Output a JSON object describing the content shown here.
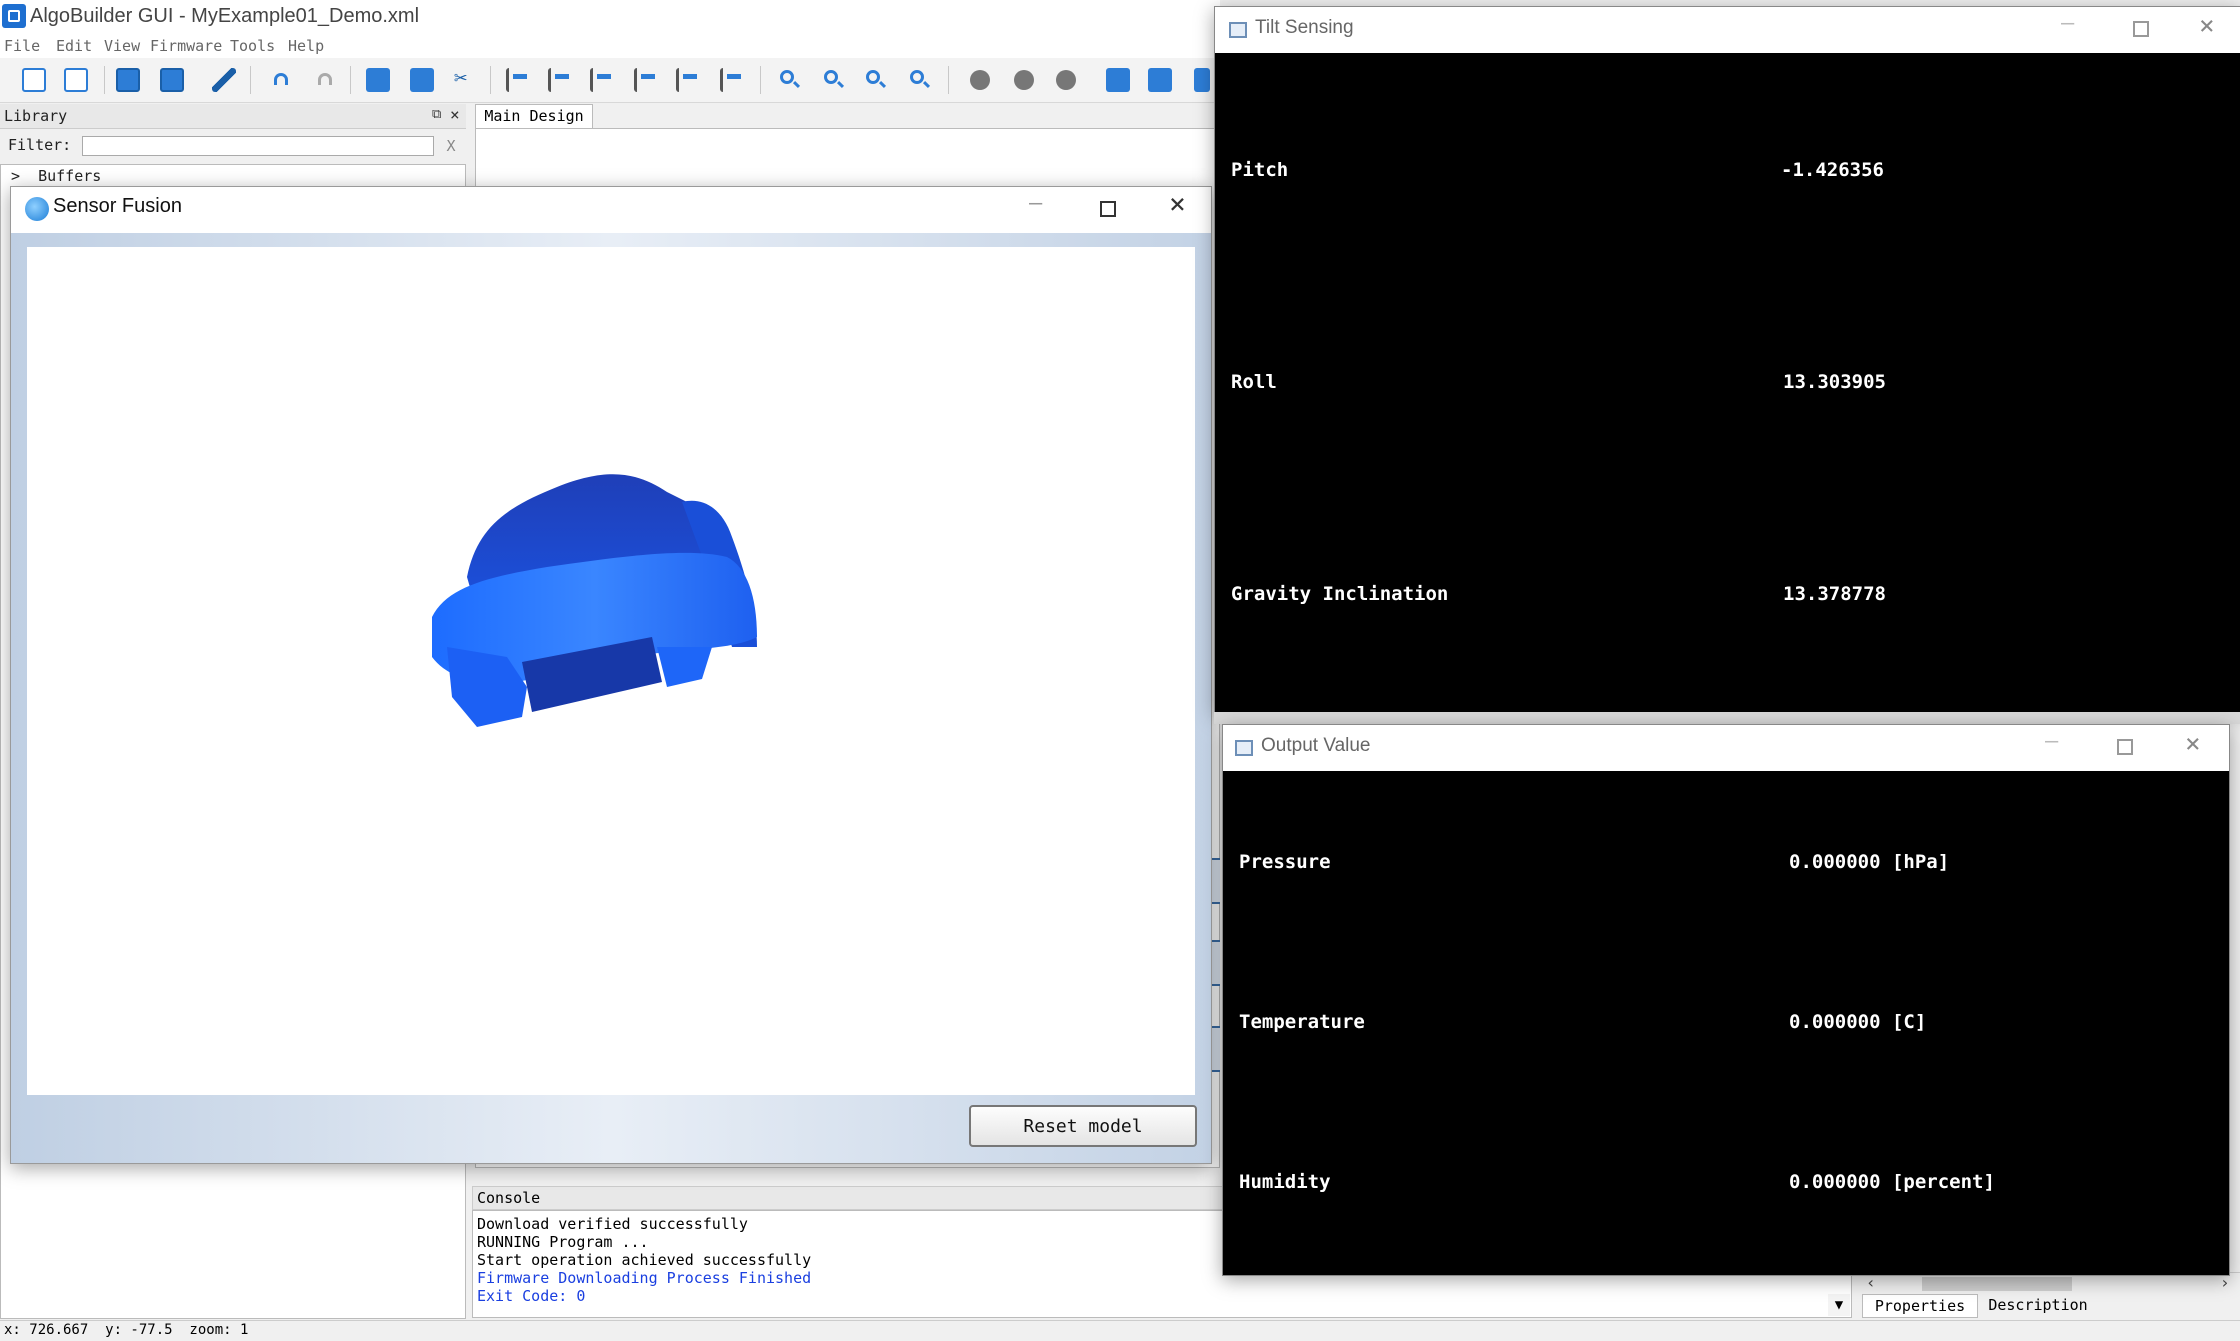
{
  "app": {
    "title": "AlgoBuilder GUI - MyExample01_Demo.xml",
    "menu": [
      "File",
      "Edit",
      "View",
      "Firmware",
      "Tools",
      "Help"
    ]
  },
  "toolbar": {
    "icons": [
      "new-file-icon",
      "new-project-icon",
      "save-icon",
      "save-as-icon",
      "settings-wrench-icon",
      "undo-icon",
      "redo-icon",
      "copy-icon",
      "paste-icon",
      "cut-icon",
      "align-left-icon",
      "align-right-icon",
      "align-center-vertical-icon",
      "align-top-icon",
      "align-bottom-icon",
      "align-center-horizontal-icon",
      "zoom-in-icon",
      "zoom-out-icon",
      "zoom-reset-icon",
      "zoom-fit-icon",
      "build-firmware-icon",
      "generate-code-icon",
      "program-target-icon",
      "excel-export-icon",
      "c-code-icon",
      "layout-icon"
    ]
  },
  "library": {
    "title": "Library",
    "filter_label": "Filter:",
    "filter_value": "",
    "filter_clear": "X",
    "tree": [
      "Buffers"
    ]
  },
  "main_design": {
    "tab_label": "Main Design"
  },
  "console": {
    "title": "Console",
    "lines": [
      {
        "text": "Download verified successfully",
        "color": "#000000"
      },
      {
        "text": "RUNNING Program ...",
        "color": "#000000"
      },
      {
        "text": "Start operation achieved successfully",
        "color": "#000000"
      },
      {
        "text": "Firmware Downloading Process Finished",
        "color": "#1a3fe0"
      },
      {
        "text": "Exit Code: 0",
        "color": "#1a3fe0"
      }
    ]
  },
  "properties": {
    "tabs": [
      "Properties",
      "Description"
    ]
  },
  "statusbar": {
    "text": "x: 726.667  y: -77.5  zoom: 1"
  },
  "sensor_fusion": {
    "title": "Sensor Fusion",
    "reset_label": "Reset model",
    "model_color": "#1a4fe0"
  },
  "tilt_sensing": {
    "title": "Tilt Sensing",
    "rows": [
      {
        "label": "Pitch",
        "value": "-1.426356"
      },
      {
        "label": "Roll",
        "value": "13.303905"
      },
      {
        "label": "Gravity Inclination",
        "value": "13.378778"
      }
    ]
  },
  "output_value": {
    "title": "Output Value",
    "rows": [
      {
        "label": "Pressure",
        "value": "0.000000 [hPa]"
      },
      {
        "label": "Temperature",
        "value": "0.000000 [C]"
      },
      {
        "label": "Humidity",
        "value": "0.000000 [percent]"
      }
    ]
  }
}
